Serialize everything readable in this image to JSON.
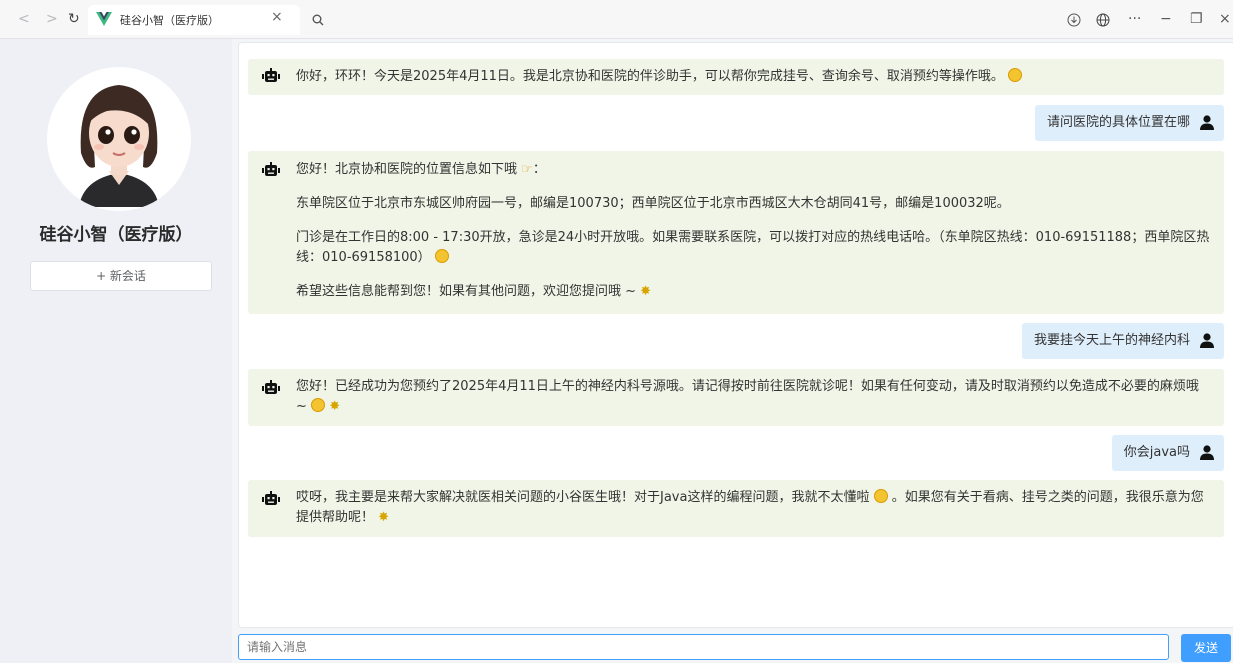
{
  "browser": {
    "tab_title": "硅谷小智（医疗版）",
    "tab_close": "×",
    "window_controls": {
      "minimize": "−",
      "restore": "❐",
      "close": "×",
      "more": "···"
    }
  },
  "sidebar": {
    "brand_title": "硅谷小智（医疗版）",
    "new_chat_label": "+ 新会话"
  },
  "messages": [
    {
      "role": "ai",
      "lines": [
        "你好，环环！今天是2025年4月11日。我是北京协和医院的伴诊助手，可以帮你完成挂号、查询余号、取消预约等操作哦。"
      ]
    },
    {
      "role": "user",
      "text": "请问医院的具体位置在哪"
    },
    {
      "role": "ai",
      "lines": [
        "您好！北京协和医院的位置信息如下哦",
        "东单院区位于北京市东城区帅府园一号，邮编是100730；西单院区位于北京市西城区大木仓胡同41号，邮编是100032呢。",
        "门诊是在工作日的8:00 - 17:30开放，急诊是24小时开放哦。如果需要联系医院，可以拨打对应的热线电话哈。（东单院区热线：010-69151188；西单院区热线：010-69158100）",
        "希望这些信息能帮到您！如果有其他问题，欢迎您提问哦 ~"
      ]
    },
    {
      "role": "user",
      "text": "我要挂今天上午的神经内科"
    },
    {
      "role": "ai",
      "lines": [
        "您好！已经成功为您预约了2025年4月11日上午的神经内科号源哦。请记得按时前往医院就诊呢！如果有任何变动，请及时取消预约以免造成不必要的麻烦哦 ~"
      ]
    },
    {
      "role": "user",
      "text": "你会java吗"
    },
    {
      "role": "ai",
      "lines": [
        "哎呀，我主要是来帮大家解决就医相关问题的小谷医生哦！对于Java这样的编程问题，我就不太懂啦",
        "。如果您有关于看病、挂号之类的问题，我很乐意为您提供帮助呢！"
      ]
    }
  ],
  "composer": {
    "placeholder": "请输入消息",
    "send_label": "发送"
  },
  "colors": {
    "accent": "#409eff",
    "ai_bubble": "#f0f5e7",
    "user_bubble": "#deeefb"
  }
}
